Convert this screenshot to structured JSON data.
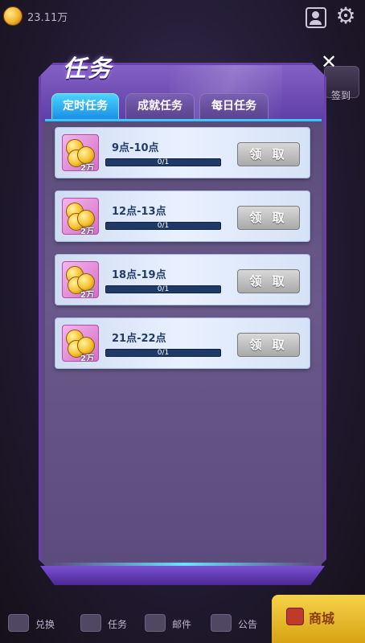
{
  "hud": {
    "coin_amount": "23.11万",
    "signin_label": "签到"
  },
  "dialog": {
    "title": "任务",
    "close_symbol": "✕",
    "tabs": [
      {
        "label": "定时任务",
        "active": true
      },
      {
        "label": "成就任务",
        "active": false
      },
      {
        "label": "每日任务",
        "active": false
      }
    ]
  },
  "tasks": [
    {
      "time_range": "9点-10点",
      "reward": "2万",
      "progress_text": "0/1",
      "progress": 0.0,
      "button_label": "领 取"
    },
    {
      "time_range": "12点-13点",
      "reward": "2万",
      "progress_text": "0/1",
      "progress": 0.0,
      "button_label": "领 取"
    },
    {
      "time_range": "18点-19点",
      "reward": "2万",
      "progress_text": "0/1",
      "progress": 0.0,
      "button_label": "领 取"
    },
    {
      "time_range": "21点-22点",
      "reward": "2万",
      "progress_text": "0/1",
      "progress": 0.0,
      "button_label": "领 取"
    }
  ],
  "bottom_nav": {
    "exchange": "兑换",
    "task": "任务",
    "mail": "邮件",
    "notice": "公告",
    "shop": "商城"
  },
  "icons": {
    "coin": "coin-icon",
    "profile": "profile-icon",
    "settings": "gear-icon",
    "close": "close-icon"
  },
  "colors": {
    "active_tab": "#1b8fe6",
    "claim_button_disabled": "#a9a9a9",
    "progress_fill": "#46c9ff"
  }
}
